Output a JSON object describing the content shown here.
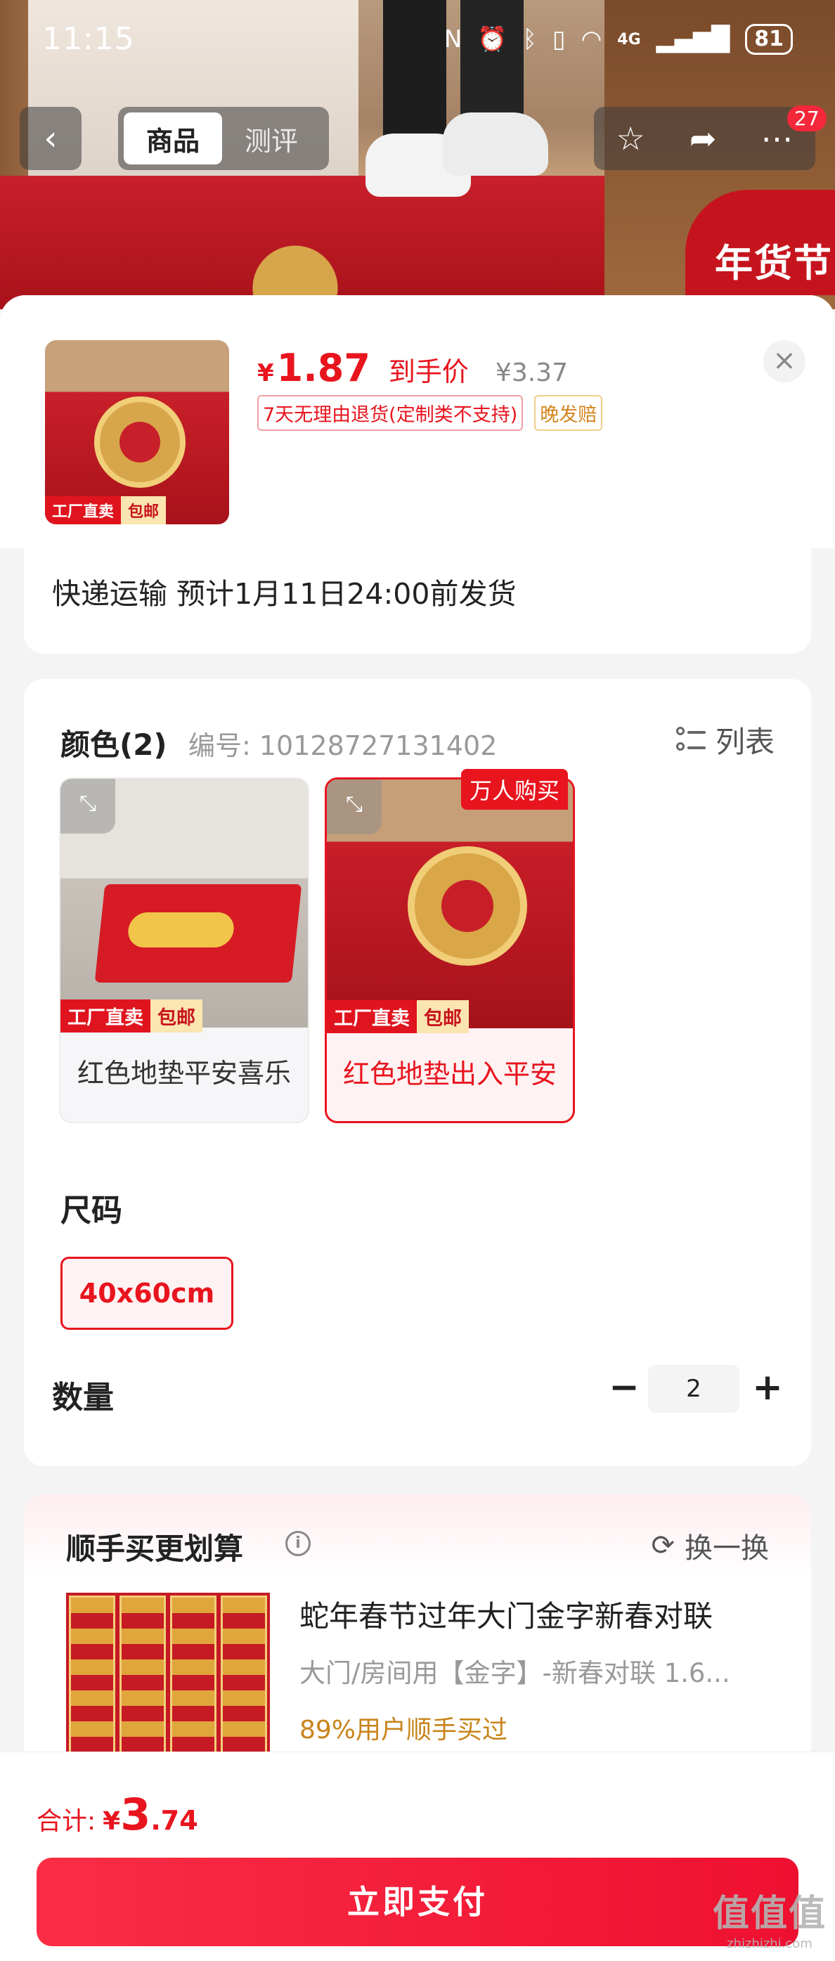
{
  "status_bar": {
    "time": "11:15",
    "icons": [
      "nfc-icon",
      "alarm-icon",
      "bluetooth-icon",
      "vibrate-icon",
      "wifi-icon",
      "signal-4g-icon"
    ],
    "network": "4G",
    "battery": "81"
  },
  "nav": {
    "tabs": [
      {
        "label": "商品",
        "active": true
      },
      {
        "label": "测评",
        "active": false
      }
    ],
    "badge_count": "27"
  },
  "banner_badge": "年货节",
  "product": {
    "thumb_tags": [
      "工厂直卖",
      "包邮"
    ],
    "price_yen": "¥",
    "price_value": "1.87",
    "price_label": "到手价",
    "original_price": "¥3.37",
    "policies": [
      "7天无理由退货(定制类不支持)",
      "晚发赔"
    ]
  },
  "shipping": {
    "text": "快递运输 预计1月11日24:00前发货"
  },
  "options": {
    "color_title": "颜色(2)",
    "code": "编号: 10128727131402",
    "list_label": "列表",
    "hot_badge": "万人购买",
    "variants": [
      {
        "label": "红色地垫平安喜乐",
        "tags": [
          "工厂直卖",
          "包邮"
        ],
        "selected": false
      },
      {
        "label": "红色地垫出入平安",
        "tags": [
          "工厂直卖",
          "包邮"
        ],
        "selected": true
      }
    ],
    "size_title": "尺码",
    "size_value": "40x60cm",
    "qty_title": "数量",
    "qty_value": "2",
    "qty_minus": "−",
    "qty_plus": "+"
  },
  "upsell": {
    "title": "顺手买更划算",
    "swap_label": "换一换",
    "item_name": "蛇年春节过年大门金字新春对联",
    "item_sub": "大门/房间用【金字】-新春对联 1.6...",
    "item_rate": "89%用户顺手买过"
  },
  "bottom": {
    "total_label": "合计:",
    "total_yen": "¥",
    "total_int": "3",
    "total_dec": ".74",
    "pay_label": "立即支付"
  },
  "watermark": {
    "main": "值值值",
    "sub": "zhizhizhi.com"
  },
  "colors": {
    "accent": "#e8141e",
    "pay_button": "#f4283a",
    "gold": "#d2861e"
  }
}
